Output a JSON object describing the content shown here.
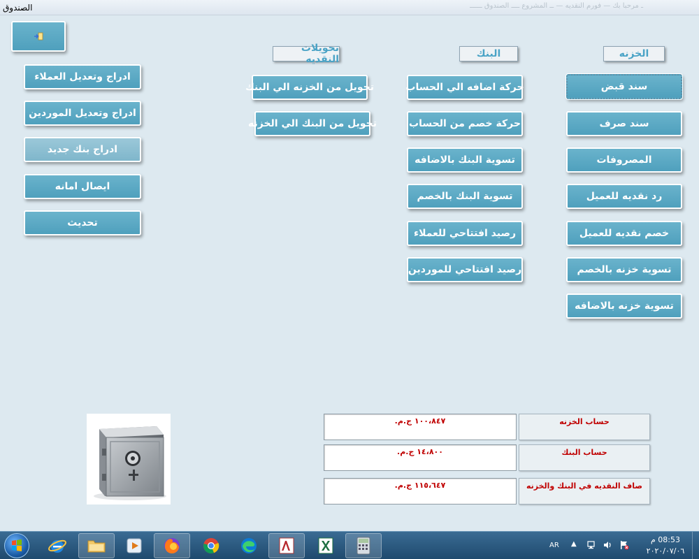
{
  "window": {
    "title": "الصندوق",
    "faint_title": "ـ مرحبا بك — فورم النقديه — ــ المشروع ــــ الصندوق ــــــ"
  },
  "headers": {
    "treasury": "الخزنه",
    "bank": "البنك",
    "transfers": "تحويلات النقديه"
  },
  "treasury_buttons": [
    "سند قبض",
    "سند صرف",
    "المصروفات",
    "رد  نقديه للعميل",
    "خصم نقديه للعميل",
    "تسوية خزنه بالخصم",
    "تسوية خزنه بالاضافه"
  ],
  "bank_buttons": [
    "حركة اضافه الي الحساب",
    "حركة خصم من الحساب",
    "تسوية البنك بالاضافه",
    "تسوية البنك بالخصم",
    "رصيد افتتاحي للعملاء",
    "رصيد افتتاحي للموردين"
  ],
  "transfer_buttons": [
    "تحويل من الخزنه الي البنك",
    "تحويل من البنك الي الخزنه"
  ],
  "left_buttons": [
    "ادراج وتعديل العملاء",
    "ادراج وتعديل الموردين",
    "ادراج بنك جديد",
    "ايصال امانه",
    "تحديث"
  ],
  "balances": [
    {
      "label": "حساب الخزنه",
      "value": "١٠٠،٨٤٧ ج.م."
    },
    {
      "label": "حساب البنك",
      "value": "١٤،٨٠٠ ج.م."
    },
    {
      "label": "صاف النقديه في البنك والخزنه",
      "value": "١١٥،٦٤٧ ج.م."
    }
  ],
  "taskbar": {
    "apps": [
      "internet-explorer",
      "file-explorer",
      "media-player",
      "firefox",
      "chrome",
      "edge",
      "access",
      "excel",
      "calculator"
    ],
    "language": "AR",
    "time": "08:53 م",
    "date": "٢٠٢٠/٠٧/٠٦"
  },
  "colors": {
    "form_bg": "#dde9f0",
    "button": "#59a8c4",
    "header_text": "#4aa3c6",
    "value_text": "#c00000",
    "taskbar": "#2b5a80"
  }
}
